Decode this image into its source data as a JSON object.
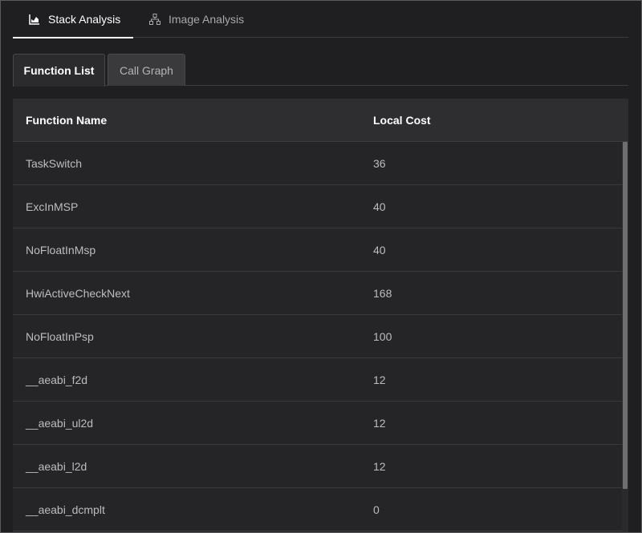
{
  "top_tabs": [
    {
      "label": "Stack Analysis",
      "icon": "area-chart-icon",
      "active": true
    },
    {
      "label": "Image Analysis",
      "icon": "hierarchy-icon",
      "active": false
    }
  ],
  "sub_tabs": [
    {
      "label": "Function List",
      "active": true
    },
    {
      "label": "Call Graph",
      "active": false
    }
  ],
  "table": {
    "columns": [
      "Function Name",
      "Local Cost"
    ],
    "rows": [
      {
        "name": "TaskSwitch",
        "cost": "36"
      },
      {
        "name": "ExcInMSP",
        "cost": "40"
      },
      {
        "name": "NoFloatInMsp",
        "cost": "40"
      },
      {
        "name": "HwiActiveCheckNext",
        "cost": "168"
      },
      {
        "name": "NoFloatInPsp",
        "cost": "100"
      },
      {
        "name": "__aeabi_f2d",
        "cost": "12"
      },
      {
        "name": "__aeabi_ul2d",
        "cost": "12"
      },
      {
        "name": "__aeabi_l2d",
        "cost": "12"
      },
      {
        "name": "__aeabi_dcmplt",
        "cost": "0"
      }
    ]
  },
  "colors": {
    "background": "#1f1f21",
    "header": "#2e2e31",
    "active_text": "#ffffff",
    "inactive_text": "#a8a8ab"
  }
}
